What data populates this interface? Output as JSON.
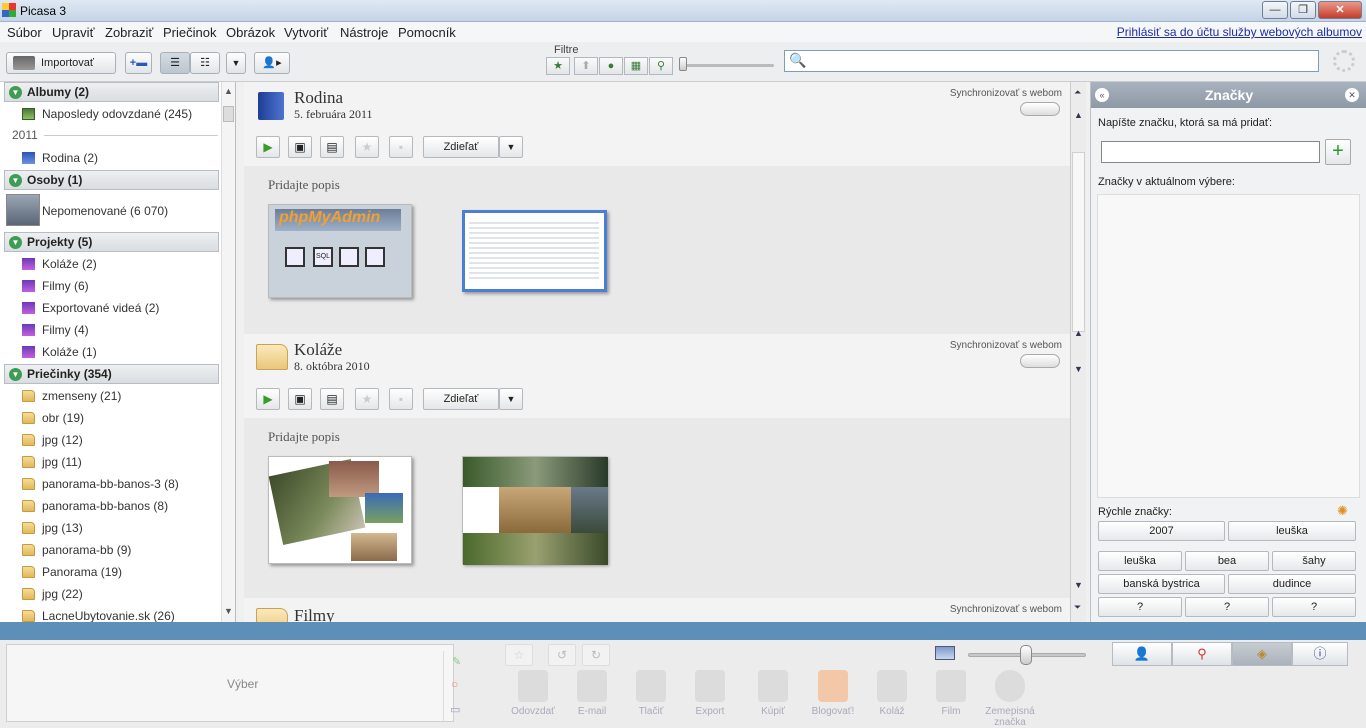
{
  "window": {
    "title": "Picasa 3",
    "min": "—",
    "max": "❐",
    "close": "✕"
  },
  "menu": [
    "Súbor",
    "Upraviť",
    "Zobraziť",
    "Priečinok",
    "Obrázok",
    "Vytvoriť",
    "Nástroje",
    "Pomocník"
  ],
  "login_link": "Prihlásiť sa do účtu služby webových albumov",
  "toolbar": {
    "import": "Importovať",
    "filters_label": "Filtre"
  },
  "sidebar": {
    "albums": {
      "header": "Albumy (2)",
      "items": [
        "Naposledy odovzdané (245)"
      ],
      "year": "2011",
      "year_items": [
        "Rodina (2)"
      ]
    },
    "people": {
      "header": "Osoby (1)",
      "items": [
        "Nepomenované (6 070)"
      ]
    },
    "projects": {
      "header": "Projekty (5)",
      "items": [
        "Koláže (2)",
        "Filmy (6)",
        "Exportované videá (2)",
        "Filmy (4)",
        "Koláže (1)"
      ]
    },
    "folders": {
      "header": "Priečinky (354)",
      "items": [
        "zmenseny (21)",
        "obr (19)",
        "jpg (12)",
        "jpg (11)",
        "panorama-bb-banos-3 (8)",
        "panorama-bb-banos (8)",
        "jpg (13)",
        "panorama-bb (9)",
        "Panorama (19)",
        "jpg (22)",
        "LacneUbytovanie.sk (26)"
      ]
    }
  },
  "albums": [
    {
      "title": "Rodina",
      "date": "5. februára 2011",
      "sync": "Synchronizovať s webom",
      "share": "Zdieľať",
      "desc": "Pridajte popis"
    },
    {
      "title": "Koláže",
      "date": "8. októbra 2010",
      "sync": "Synchronizovať s webom",
      "share": "Zdieľať",
      "desc": "Pridajte popis"
    },
    {
      "title": "Filmy",
      "sync": "Synchronizovať s webom"
    }
  ],
  "thumb_text": {
    "phpmyadmin": "phpMyAdmin",
    "sql": "SQL"
  },
  "tags": {
    "title": "Značky",
    "prompt": "Napíšte značku, ktorá sa má pridať:",
    "current": "Značky v aktuálnom výbere:",
    "quick": "Rýchle značky:",
    "quick_row1": [
      "2007",
      "leuška"
    ],
    "quick_row2": [
      "leuška",
      "bea",
      "šahy"
    ],
    "quick_row3": [
      "banská bystrica",
      "dudince"
    ],
    "quick_row4": [
      "?",
      "?",
      "?"
    ]
  },
  "bottom": {
    "selection": "Výber",
    "actions": [
      "Odovzdať",
      "E-mail",
      "Tlačiť",
      "Export",
      "Kúpiť",
      "Blogovať!",
      "Koláž",
      "Film",
      "Zemepisná značka"
    ]
  },
  "colors": {
    "accent": "#5d8fb8",
    "play": "#3a9a2a"
  }
}
